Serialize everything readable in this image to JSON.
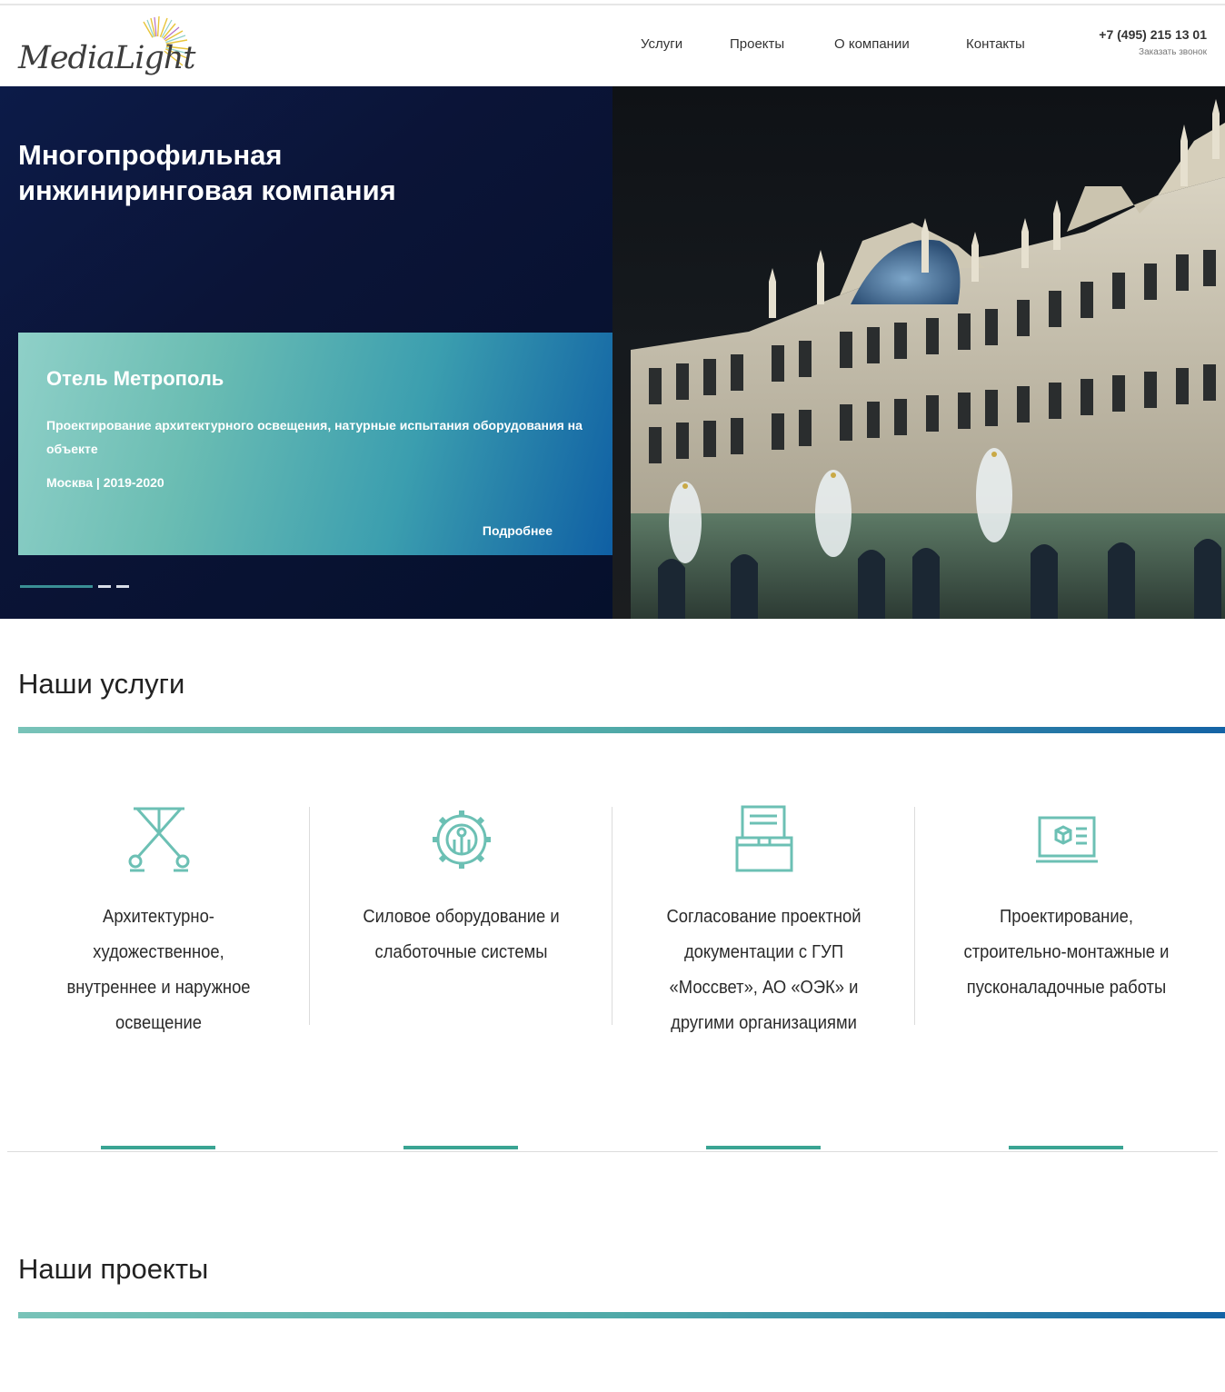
{
  "header": {
    "logo_text": "MediaLight",
    "nav": [
      "Услуги",
      "Проекты",
      "О компании",
      "Контакты"
    ],
    "phone": "+7 (495) 215 13 01",
    "callback": "Заказать звонок"
  },
  "hero": {
    "title": "Многопрофильная инжиниринговая компания",
    "card": {
      "title": "Отель Метрополь",
      "description": "Проектирование архитектурного освещения, натурные испытания оборудования на объекте",
      "meta": "Москва | 2019-2020",
      "more": "Подробнее"
    },
    "slides_total": 3,
    "active_slide": 1
  },
  "services": {
    "title": "Наши услуги",
    "items": [
      {
        "label": "Архитектурно-художественное, внутреннее и наружное освещение",
        "icon": "tripod-lamp-icon"
      },
      {
        "label": "Силовое оборудование и слаботочные системы",
        "icon": "gear-circuit-icon"
      },
      {
        "label": "Согласование проектной документации с ГУП «Моссвет», АО «ОЭК» и другими организациями",
        "icon": "document-box-icon"
      },
      {
        "label": "Проектирование, строительно-монтажные и пусконаладочные работы",
        "icon": "laptop-cube-icon"
      }
    ]
  },
  "projects": {
    "title": "Наши проекты"
  },
  "colors": {
    "accent": "#3aa493",
    "hero_dark": "#0b1437",
    "gradient_start": "#78c3b8",
    "gradient_end": "#1463a5"
  }
}
